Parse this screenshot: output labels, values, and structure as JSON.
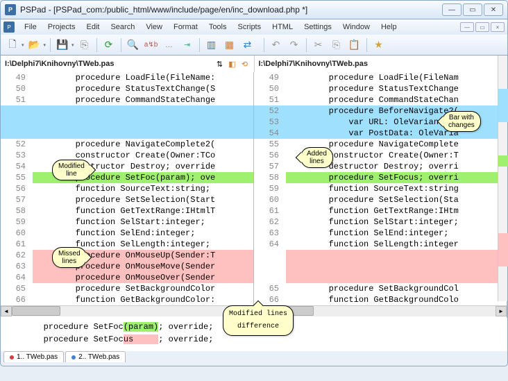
{
  "window": {
    "title": "PSPad - [PSPad_com:/public_html/www/include/page/en/inc_download.php *]"
  },
  "menu": [
    "File",
    "Projects",
    "Edit",
    "Search",
    "View",
    "Format",
    "Tools",
    "Scripts",
    "HTML",
    "Settings",
    "Window",
    "Help"
  ],
  "path_left": "I:\\Delphi7\\Knihovny\\TWeb.pas",
  "path_right": "I:\\Delphi7\\Knihovny\\TWeb.pas",
  "left_lines": [
    {
      "n": "49",
      "t": "        procedure LoadFile(FileName:",
      "cls": ""
    },
    {
      "n": "50",
      "t": "        procedure StatusTextChange(S",
      "cls": ""
    },
    {
      "n": "51",
      "t": "        procedure CommandStateChange",
      "cls": ""
    },
    {
      "n": "",
      "t": "",
      "cls": "added"
    },
    {
      "n": "",
      "t": "",
      "cls": "added"
    },
    {
      "n": "",
      "t": "",
      "cls": "added"
    },
    {
      "n": "52",
      "t": "        procedure NavigateComplete2(",
      "cls": ""
    },
    {
      "n": "53",
      "t": "        constructor Create(Owner:TCo",
      "cls": ""
    },
    {
      "n": "54",
      "t": "        destructor Destroy; override",
      "cls": ""
    },
    {
      "n": "55",
      "t": "        procedure SetFoc(param); ove",
      "cls": "modified"
    },
    {
      "n": "56",
      "t": "        function SourceText:string;",
      "cls": ""
    },
    {
      "n": "57",
      "t": "        procedure SetSelection(Start",
      "cls": ""
    },
    {
      "n": "58",
      "t": "        function GetTextRange:IHtmlT",
      "cls": ""
    },
    {
      "n": "59",
      "t": "        function SelStart:integer;",
      "cls": ""
    },
    {
      "n": "60",
      "t": "        function SelEnd:integer;",
      "cls": ""
    },
    {
      "n": "61",
      "t": "        function SelLength:integer;",
      "cls": ""
    },
    {
      "n": "62",
      "t": "        procedure OnMouseUp(Sender:T",
      "cls": "missed"
    },
    {
      "n": "63",
      "t": "        procedure OnMouseMove(Sender",
      "cls": "missed"
    },
    {
      "n": "64",
      "t": "        procedure OnMouseOver(Sender",
      "cls": "missed"
    },
    {
      "n": "65",
      "t": "        procedure SetBackgroundColor",
      "cls": ""
    },
    {
      "n": "66",
      "t": "        function GetBackgroundColor:",
      "cls": ""
    }
  ],
  "right_lines": [
    {
      "n": "49",
      "t": "        procedure LoadFile(FileNam",
      "cls": ""
    },
    {
      "n": "50",
      "t": "        procedure StatusTextChange",
      "cls": ""
    },
    {
      "n": "51",
      "t": "        procedure CommandStateChan",
      "cls": ""
    },
    {
      "n": "52",
      "t": "        procedure BeforeNavigate2(",
      "cls": "added"
    },
    {
      "n": "53",
      "t": "            var URL: OleVariant; v",
      "cls": "added"
    },
    {
      "n": "54",
      "t": "            var PostData: OleVaria",
      "cls": "added"
    },
    {
      "n": "55",
      "t": "        procedure NavigateComplete",
      "cls": ""
    },
    {
      "n": "56",
      "t": "        constructor Create(Owner:T",
      "cls": ""
    },
    {
      "n": "57",
      "t": "        destructor Destroy; overri",
      "cls": ""
    },
    {
      "n": "58",
      "t": "        procedure SetFocus; overri",
      "cls": "modified"
    },
    {
      "n": "59",
      "t": "        function SourceText:string",
      "cls": ""
    },
    {
      "n": "60",
      "t": "        procedure SetSelection(Sta",
      "cls": ""
    },
    {
      "n": "61",
      "t": "        function GetTextRange:IHtm",
      "cls": ""
    },
    {
      "n": "62",
      "t": "        function SelStart:integer;",
      "cls": ""
    },
    {
      "n": "63",
      "t": "        function SelEnd:integer;",
      "cls": ""
    },
    {
      "n": "64",
      "t": "        function SelLength:integer",
      "cls": ""
    },
    {
      "n": "",
      "t": "",
      "cls": "missed"
    },
    {
      "n": "",
      "t": "",
      "cls": "missed"
    },
    {
      "n": "",
      "t": "",
      "cls": "missed"
    },
    {
      "n": "65",
      "t": "        procedure SetBackgroundCol",
      "cls": ""
    },
    {
      "n": "66",
      "t": "        function GetBackgroundColo",
      "cls": ""
    }
  ],
  "callouts": {
    "modified_line": "Modified\nline",
    "added_lines": "Added\nlines",
    "bar_changes": "Bar with\nchanges",
    "missed_lines": "Missed\nlines",
    "modified_diff": "Modified lines\ndifference"
  },
  "diff_bottom": {
    "line1_pre": "   procedure SetFoc",
    "line1_hl": "(param)",
    "line1_post": "; override;",
    "line2_pre": "   procedure SetFoc",
    "line2_hl": "us     ",
    "line2_post": "; override;"
  },
  "tabs": [
    {
      "label": "1.. TWeb.pas",
      "color": "#d04040"
    },
    {
      "label": "2.. TWeb.pas",
      "color": "#4080d0"
    }
  ]
}
